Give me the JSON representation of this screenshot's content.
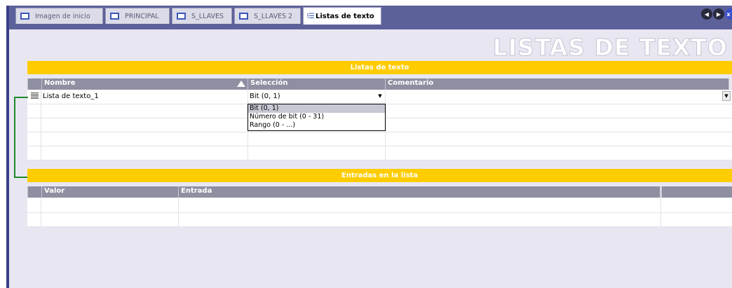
{
  "tabs": [
    {
      "label": "Imagen de inicio",
      "active": false
    },
    {
      "label": "PRINCIPAL",
      "active": false
    },
    {
      "label": "S_LLAVES",
      "active": false
    },
    {
      "label": "S_LLAVES 2",
      "active": false
    },
    {
      "label": "Listas de texto",
      "active": true
    }
  ],
  "nav_icons": [
    "previous-icon",
    "next-icon",
    "close-icon"
  ],
  "page_title": "LISTAS DE TEXTO",
  "text_lists": {
    "section_title": "Listas de texto",
    "columns": [
      "Nombre",
      "Selección",
      "Comentario"
    ],
    "rows": [
      {
        "name": "Lista de texto_1",
        "selection": "Bit (0, 1)",
        "comment": ""
      }
    ],
    "dropdown_options": [
      "Bit (0, 1)",
      "Número de bit (0 - 31)",
      "Rango (0 - ...)"
    ],
    "dropdown_selected": "Bit (0, 1)"
  },
  "entries": {
    "section_title": "Entradas en la lista",
    "columns": [
      "Valor",
      "Entrada"
    ]
  },
  "colors": {
    "header_yellow": "#ffcc00",
    "column_header": "#8f8fa2",
    "tab_bar": "#5d619a",
    "connector_green": "#1f8a2b"
  }
}
